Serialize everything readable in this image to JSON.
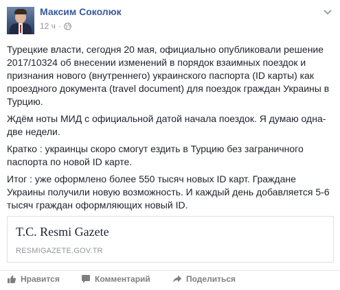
{
  "post": {
    "author": "Максим Соколюк",
    "timestamp": "12 ч",
    "separator": "·",
    "paragraphs": [
      "Турецкие власти, сегодня 20 мая, официально опубликовали решение 2017/10324 об внесении изменений в порядок взаимных поездок и признания нового (внутреннего) украинского паспорта (ID карты) как проездного документа (travel document) для поездок граждан Украины в Турцию.",
      "Ждём ноты МИД с официальной датой начала поездок. Я думаю одна-две недели.",
      "Кратко : украинцы скоро смогут ездить в Турцию без заграничного паспорта по новой ID карте.",
      "Итог : уже оформлено более 550 тысяч новых ID карт. Граждане Украины получили новую возможность. И каждый день добавляется 5-6 тысяч граждан оформляющих новый ID."
    ]
  },
  "link_preview": {
    "title": "T.C. Resmi Gazete",
    "domain": "RESMIGAZETE.GOV.TR"
  },
  "actions": {
    "like": "Нравится",
    "comment": "Комментарий",
    "share": "Поделиться"
  },
  "icons": {
    "privacy": "globe-icon",
    "menu": "chevron-down-icon",
    "like": "thumbs-up-icon",
    "comment": "comment-bubble-icon",
    "share": "share-arrow-icon"
  },
  "colors": {
    "author_link": "#365899",
    "meta_text": "#90949c",
    "action_text": "#7f7f7f"
  }
}
